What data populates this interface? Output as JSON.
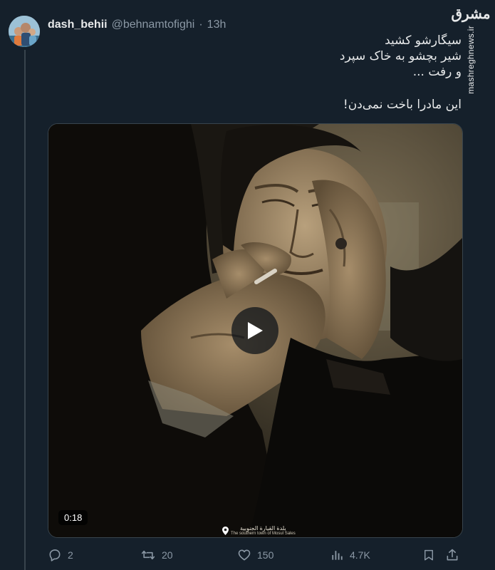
{
  "tweet": {
    "display_name": "dash_behii",
    "handle": "@behnamtofighi",
    "separator": "·",
    "time": "13h",
    "text_lines": [
      "سیگارشو کشید",
      "شیر بچشو به خاک سپرد",
      "و رفت ..."
    ],
    "text_line_2": "این مادرا باخت نمی‌دن!"
  },
  "watermark": {
    "logo": "مشرق",
    "site": "mashreghnews.ir"
  },
  "media": {
    "duration": "0:18",
    "caption_arabic": "بلدة القيارة الجنوبية",
    "caption_english": "The southern town of Mosul Sales",
    "play_icon": "play-icon"
  },
  "actions": {
    "replies": "2",
    "retweets": "20",
    "likes": "150",
    "views": "4.7K"
  },
  "colors": {
    "background": "#15202b",
    "text": "#e7e9ea",
    "secondary": "#8b98a5",
    "border": "#38444d"
  }
}
